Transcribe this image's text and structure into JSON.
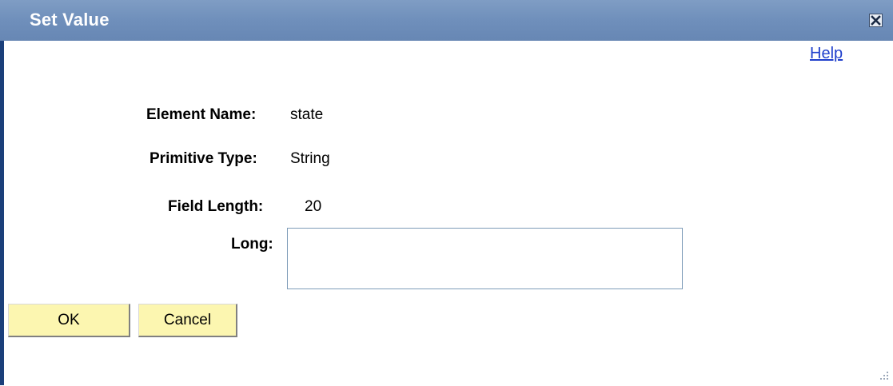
{
  "dialog": {
    "title": "Set Value",
    "close_icon": "close-icon",
    "help_label": "Help"
  },
  "fields": {
    "element_name_label": "Element Name:",
    "element_name_value": "state",
    "primitive_type_label": "Primitive Type:",
    "primitive_type_value": "String",
    "field_length_label": "Field Length:",
    "field_length_value": "20",
    "long_label": "Long:",
    "long_value": ""
  },
  "buttons": {
    "ok_label": "OK",
    "cancel_label": "Cancel"
  },
  "colors": {
    "titlebar": "#6f8fbb",
    "title_text": "#ffffff",
    "left_rule": "#1b3f7a",
    "link": "#1f3fcc",
    "button_bg": "#fcf6b0",
    "input_border": "#7f9db9"
  },
  "icons": {
    "close": "close-icon",
    "resize": "resize-grip-icon"
  }
}
